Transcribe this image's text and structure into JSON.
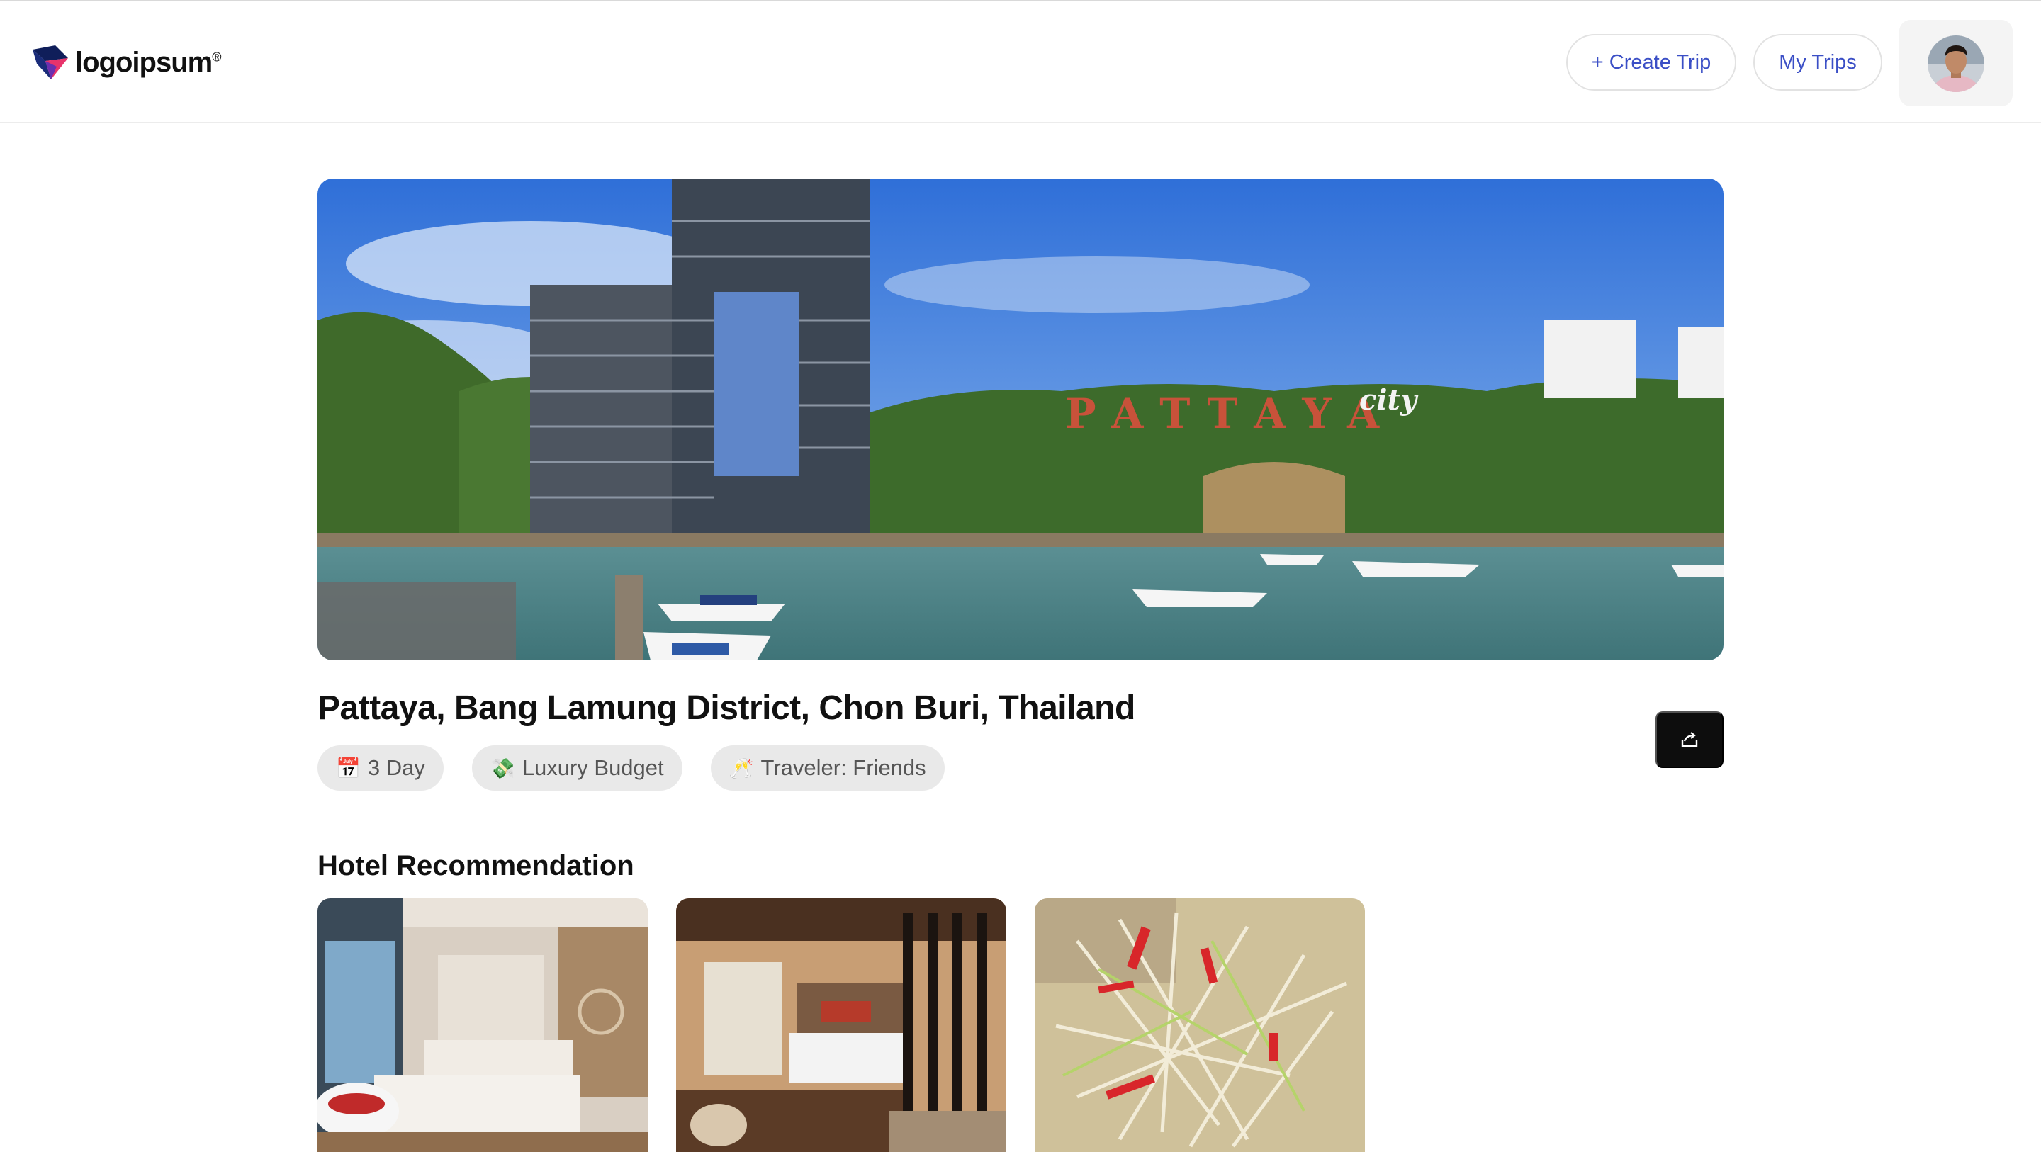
{
  "header": {
    "logo_text": "logoipsum",
    "logo_mark": "®",
    "create_trip_label": "+ Create Trip",
    "my_trips_label": "My Trips"
  },
  "hero": {
    "sign_text": "PATTAYA",
    "sign_sub": "city"
  },
  "trip": {
    "location": "Pattaya, Bang Lamung District, Chon Buri, Thailand",
    "chips": [
      {
        "icon": "📅",
        "label": "3 Day"
      },
      {
        "icon": "💸",
        "label": "Luxury Budget"
      },
      {
        "icon": "🥂",
        "label": "Traveler: Friends"
      }
    ]
  },
  "hotels": {
    "section_title": "Hotel Recommendation"
  },
  "colors": {
    "accent": "#3b4fc6",
    "dark_button": "#0d0d0d",
    "chip_bg": "#e9e9e9"
  },
  "icons": {
    "share": "share-icon",
    "logo": "logo-icon",
    "avatar": "avatar"
  }
}
